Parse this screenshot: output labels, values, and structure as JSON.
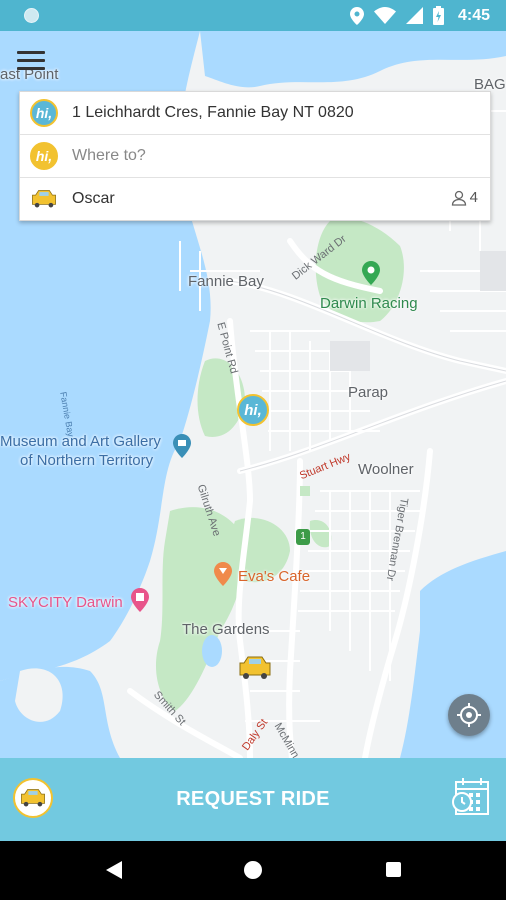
{
  "status_bar": {
    "time": "4:45",
    "icons": [
      "location-icon",
      "wifi-icon",
      "signal-icon",
      "battery-icon"
    ]
  },
  "map": {
    "labels": {
      "east_point": "ast Point",
      "bag": "BAG",
      "fannie_bay": "Fannie Bay",
      "darwin_racing": "Darwin Racing",
      "parap": "Parap",
      "museum_line1": "Museum and Art Gallery",
      "museum_line2": "of Northern Territory",
      "woolner": "Woolner",
      "evas_cafe": "Eva's Cafe",
      "skycity": "SKYCITY Darwin",
      "the_gardens": "The Gardens"
    },
    "roads": {
      "dick_ward": "Dick Ward Dr",
      "e_point": "E Point Rd",
      "fannie_bay_water": "Fannie Bay",
      "stuart_hwy": "Stuart Hwy",
      "tiger_brennan": "Tiger Brennan Dr",
      "gilruth": "Gilruth Ave",
      "smith": "Smith St",
      "daly": "Daly St",
      "mcminn": "McMinn"
    },
    "route_shield": "1"
  },
  "trip_card": {
    "pickup": {
      "badge": "hi,",
      "text": "1 Leichhardt Cres,  Fannie Bay NT 0820"
    },
    "destination": {
      "badge": "hi,",
      "placeholder": "Where to?"
    },
    "vehicle": {
      "name": "Oscar",
      "passengers": "4"
    }
  },
  "marker": {
    "badge": "hi,"
  },
  "bottom_bar": {
    "request_label": "REQUEST RIDE"
  },
  "colors": {
    "status_bar": "#4fb5cf",
    "bottom_bar": "#72c9e0",
    "accent_yellow": "#f2c230",
    "water": "#aadaff",
    "park": "#c5e8c5"
  }
}
